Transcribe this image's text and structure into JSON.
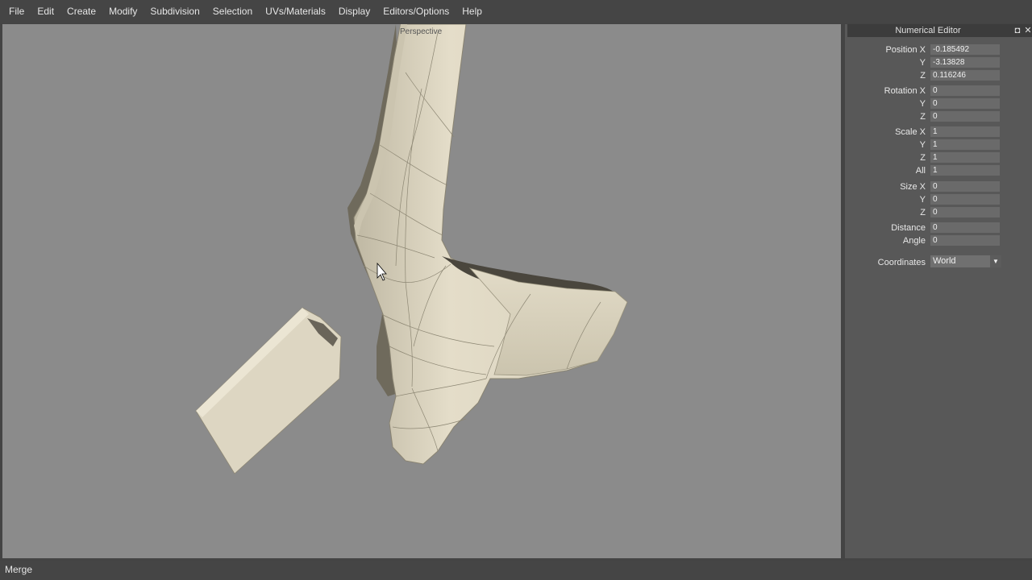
{
  "menubar": {
    "items": [
      "File",
      "Edit",
      "Create",
      "Modify",
      "Subdivision",
      "Selection",
      "UVs/Materials",
      "Display",
      "Editors/Options",
      "Help"
    ]
  },
  "viewport": {
    "label": "Perspective"
  },
  "panel": {
    "title": "Numerical Editor",
    "restore_icon": "restore-icon",
    "close_icon": "close-icon",
    "position": {
      "label": "Position X",
      "x": "-0.185492",
      "y_label": "Y",
      "y": "-3.13828",
      "z_label": "Z",
      "z": "0.116246"
    },
    "rotation": {
      "label": "Rotation X",
      "x": "0",
      "y_label": "Y",
      "y": "0",
      "z_label": "Z",
      "z": "0"
    },
    "scale": {
      "label": "Scale X",
      "x": "1",
      "y_label": "Y",
      "y": "1",
      "z_label": "Z",
      "z": "1",
      "all_label": "All",
      "all": "1"
    },
    "size": {
      "label": "Size X",
      "x": "0",
      "y_label": "Y",
      "y": "0",
      "z_label": "Z",
      "z": "0"
    },
    "distance": {
      "label": "Distance",
      "value": "0"
    },
    "angle": {
      "label": "Angle",
      "value": "0"
    },
    "coordinates": {
      "label": "Coordinates",
      "value": "World"
    }
  },
  "status": {
    "text": "Merge"
  },
  "colors": {
    "viewport_bg": "#8b8b8b",
    "model": "#ddd6c2",
    "panel_bg": "#585858",
    "menubar_bg": "#454545"
  }
}
